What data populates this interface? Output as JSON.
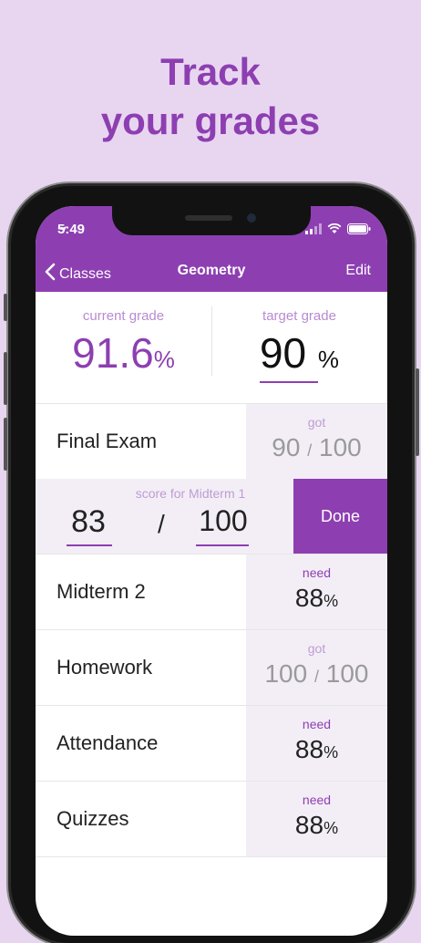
{
  "headline": {
    "line1": "Track",
    "line2": "your grades"
  },
  "status": {
    "time": "5:49"
  },
  "nav": {
    "back_label": "Classes",
    "title": "Geometry",
    "edit_label": "Edit"
  },
  "summary": {
    "current": {
      "label": "current grade",
      "value": "91.6",
      "unit": "%"
    },
    "target": {
      "label": "target grade",
      "value": "90",
      "unit": "%"
    }
  },
  "rows": [
    {
      "name": "Final Exam",
      "status": "got",
      "got": "90",
      "sep": "/",
      "total": "100"
    },
    {
      "editing": true,
      "label": "score for Midterm 1",
      "got": "83",
      "sep": "/",
      "total": "100",
      "done_label": "Done"
    },
    {
      "name": "Midterm 2",
      "status": "need",
      "value": "88",
      "unit": "%"
    },
    {
      "name": "Homework",
      "status": "got",
      "got": "100",
      "sep": "/",
      "total": "100"
    },
    {
      "name": "Attendance",
      "status": "need",
      "value": "88",
      "unit": "%"
    },
    {
      "name": "Quizzes",
      "status": "need",
      "value": "88",
      "unit": "%"
    }
  ],
  "colors": {
    "accent": "#8d3fb1",
    "background": "#e8d6f0",
    "cell": "#f3eef6"
  }
}
